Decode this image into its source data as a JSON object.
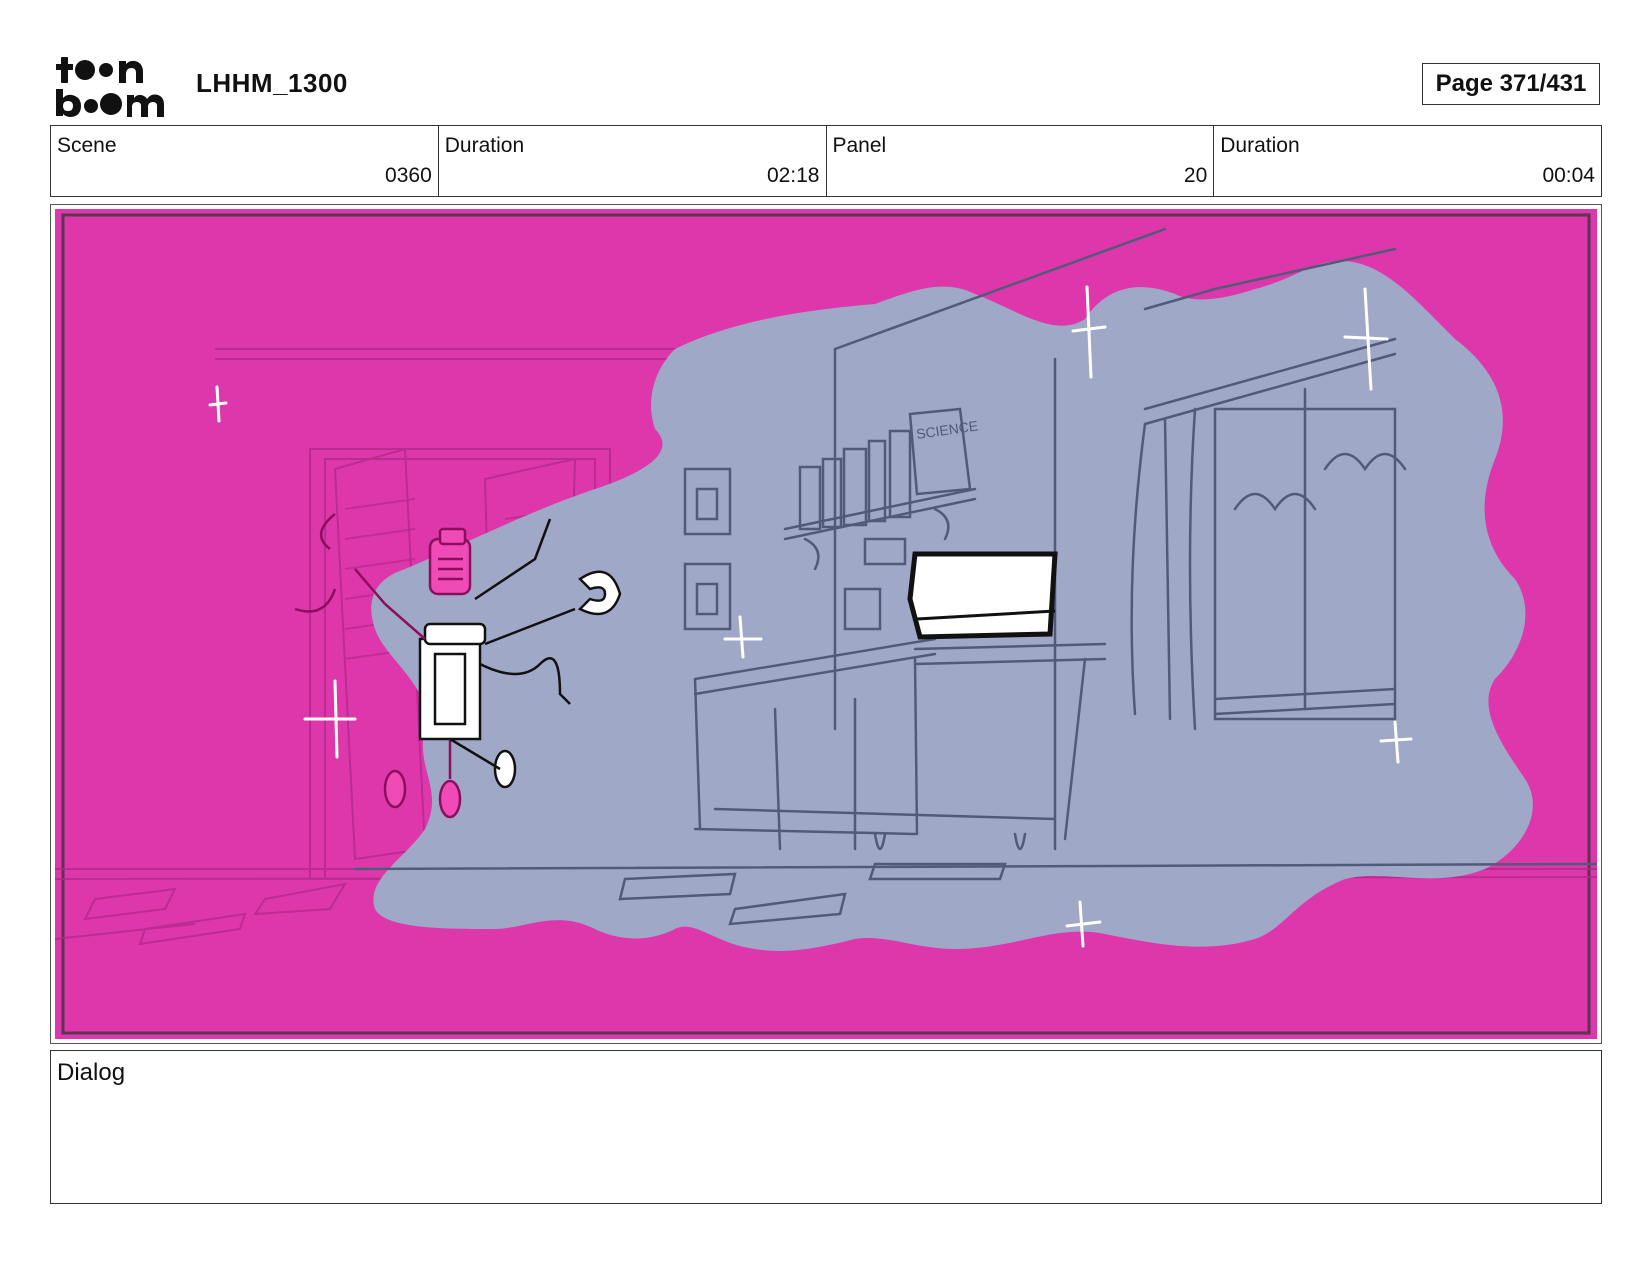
{
  "header": {
    "logo_text": "toonboom",
    "project_title": "LHHM_1300",
    "page_label": "Page 371/431"
  },
  "info": [
    {
      "label": "Scene",
      "value": "0360"
    },
    {
      "label": "Duration",
      "value": "02:18"
    },
    {
      "label": "Panel",
      "value": "20"
    },
    {
      "label": "Duration",
      "value": "00:04"
    }
  ],
  "panel": {
    "book_text": "SCIENCE",
    "colors": {
      "magenta": "#de37ac",
      "lavender": "#a0a8c8",
      "line": "#525a7a"
    }
  },
  "dialog": {
    "label": "Dialog",
    "text": ""
  }
}
